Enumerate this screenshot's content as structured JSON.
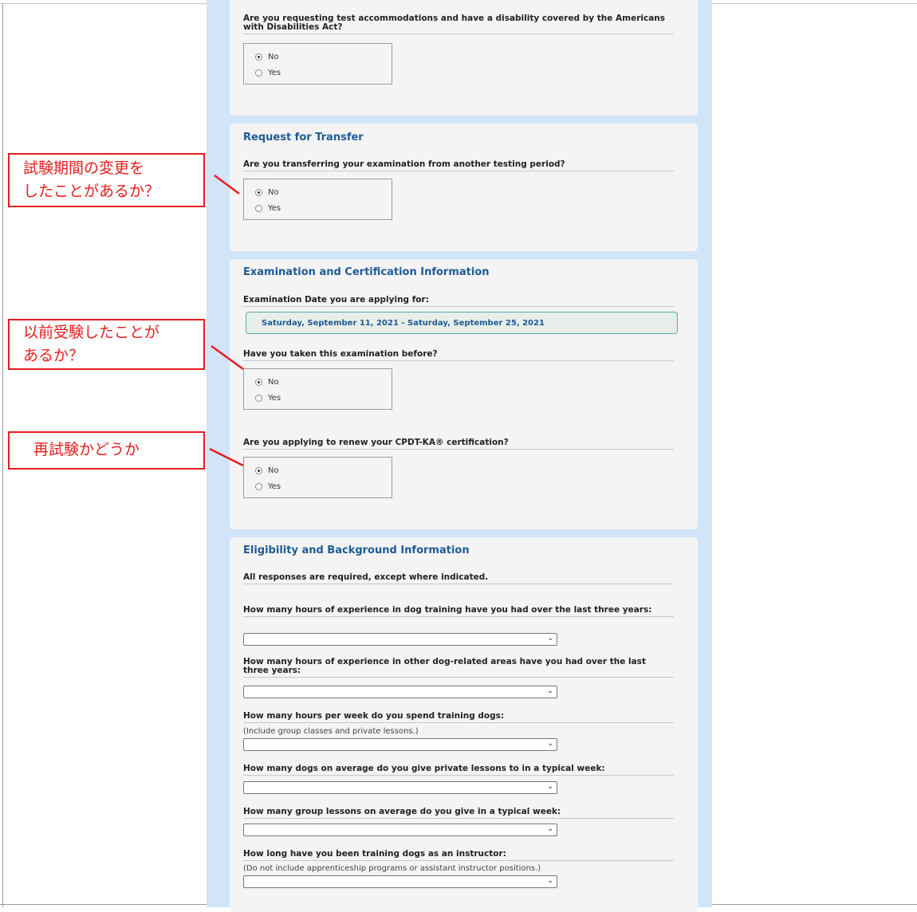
{
  "ada_question": {
    "question": "Are you requesting test accommodations and have a disability covered by the Americans with Disabilities Act?",
    "options": [
      "No",
      "Yes"
    ],
    "selected": "No"
  },
  "transfer": {
    "title": "Request for Transfer",
    "question": "Are you transferring your examination from another testing period?",
    "options": [
      "No",
      "Yes"
    ],
    "selected": "No"
  },
  "exam_info": {
    "title": "Examination and Certification Information",
    "date_label": "Examination Date you are applying for:",
    "date_value": "Saturday, September 11, 2021 - Saturday, September 25, 2021",
    "taken_before_question": "Have you taken this examination before?",
    "taken_before_options": [
      "No",
      "Yes"
    ],
    "taken_before_selected": "No",
    "renew_question": "Are you applying to renew your CPDT-KA® certification?",
    "renew_options": [
      "No",
      "Yes"
    ],
    "renew_selected": "No"
  },
  "eligibility": {
    "title": "Eligibility and Background Information",
    "intro": "All responses are required, except where indicated.",
    "questions": [
      {
        "label": "How many hours of experience in dog training have you had over the last three years:",
        "hint": ""
      },
      {
        "label": "How many hours of experience in other dog-related areas have you had over the last three years:",
        "hint": ""
      },
      {
        "label": "How many hours per week do you spend training dogs:",
        "hint": "(Include group classes and private lessons.)"
      },
      {
        "label": "How many dogs on average do you give private lessons to in a typical week:",
        "hint": ""
      },
      {
        "label": "How many group lessons on average do you give in a typical week:",
        "hint": ""
      },
      {
        "label": "How long have you been training dogs as an instructor:",
        "hint": "(Do not include apprenticeship programs or assistant instructor positions.)"
      }
    ]
  },
  "callouts": {
    "transfer": [
      "試験期間の変更を",
      "したことがあるか？"
    ],
    "taken_before": [
      "以前受験したことが",
      "あるか？"
    ],
    "retest": [
      "再試験かどうか"
    ]
  },
  "colors": {
    "annotation": "#e61e1e",
    "section_title": "#1f5a96",
    "column_bg": "#d2e4f8"
  },
  "icons": {
    "select_arrow": "chevron-down-icon"
  }
}
